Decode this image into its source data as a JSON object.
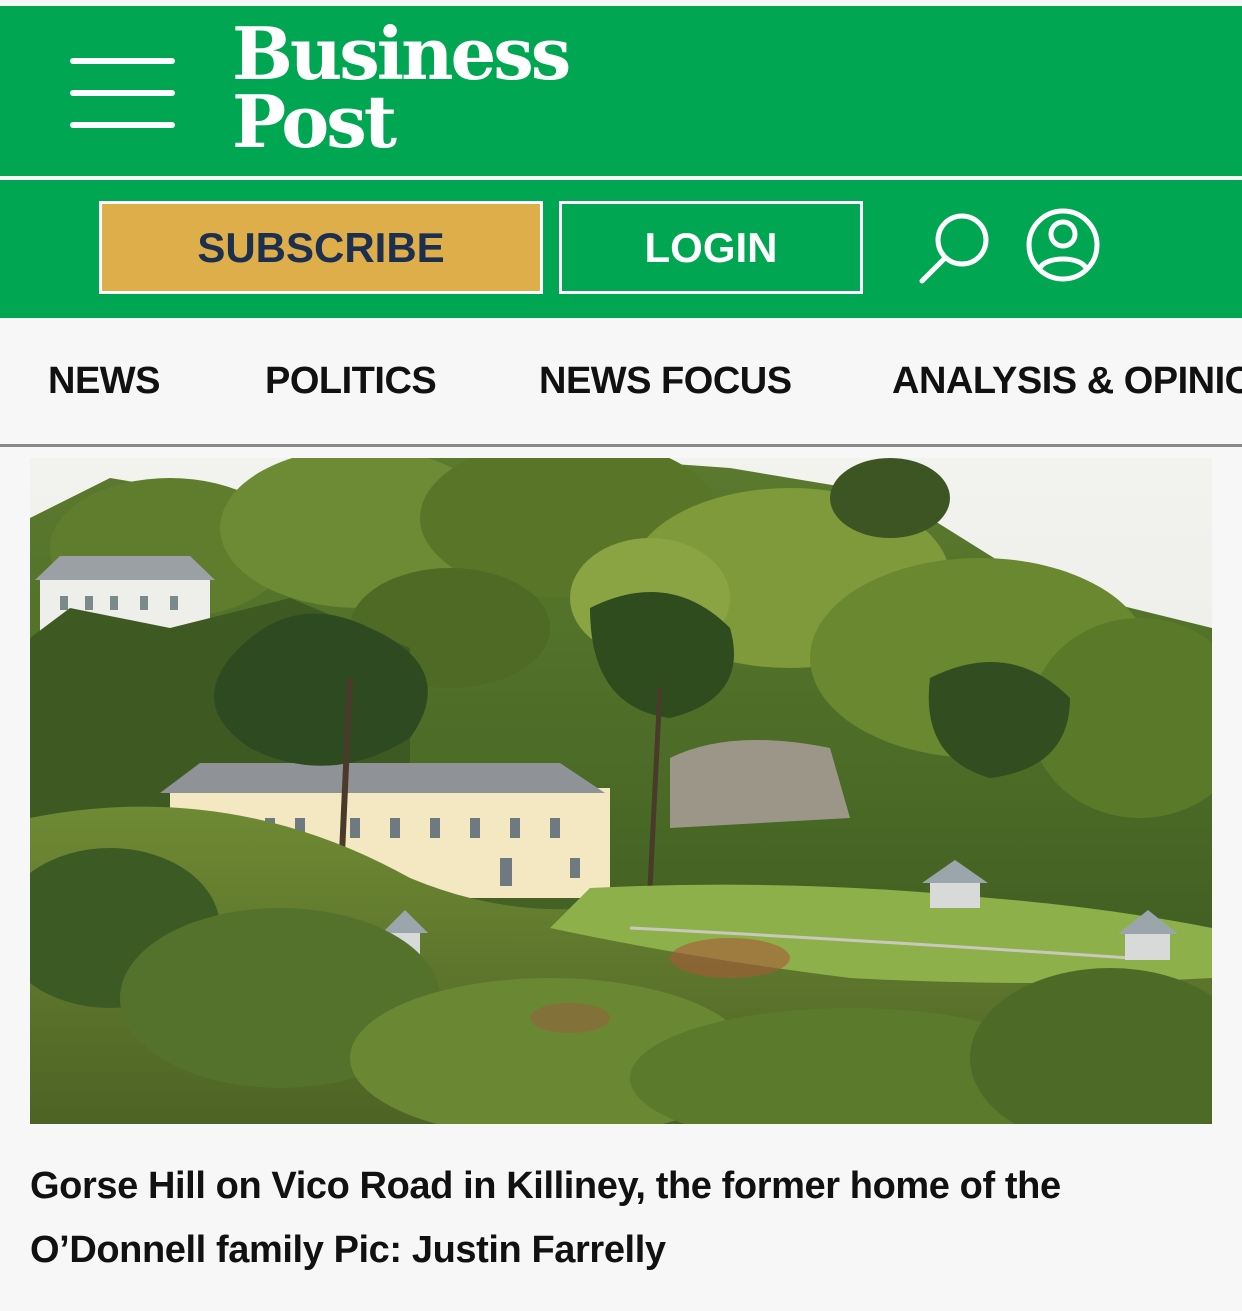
{
  "header": {
    "logo_line1": "Business",
    "logo_line2": "Post",
    "subscribe_label": "SUBSCRIBE",
    "login_label": "LOGIN",
    "brand_color": "#00a651",
    "subscribe_color": "#deae4a"
  },
  "nav": {
    "items": [
      {
        "label": "NEWS"
      },
      {
        "label": "POLITICS"
      },
      {
        "label": "NEWS FOCUS"
      },
      {
        "label": "ANALYSIS & OPINIC"
      }
    ]
  },
  "article": {
    "hero_image_icon": "landscape-photo",
    "caption": "Gorse Hill on Vico Road in Killiney, the former home of the O’Donnell family Pic: Justin Farrelly"
  },
  "icons": {
    "menu": "hamburger-menu-icon",
    "search": "search-icon",
    "account": "user-account-icon"
  }
}
